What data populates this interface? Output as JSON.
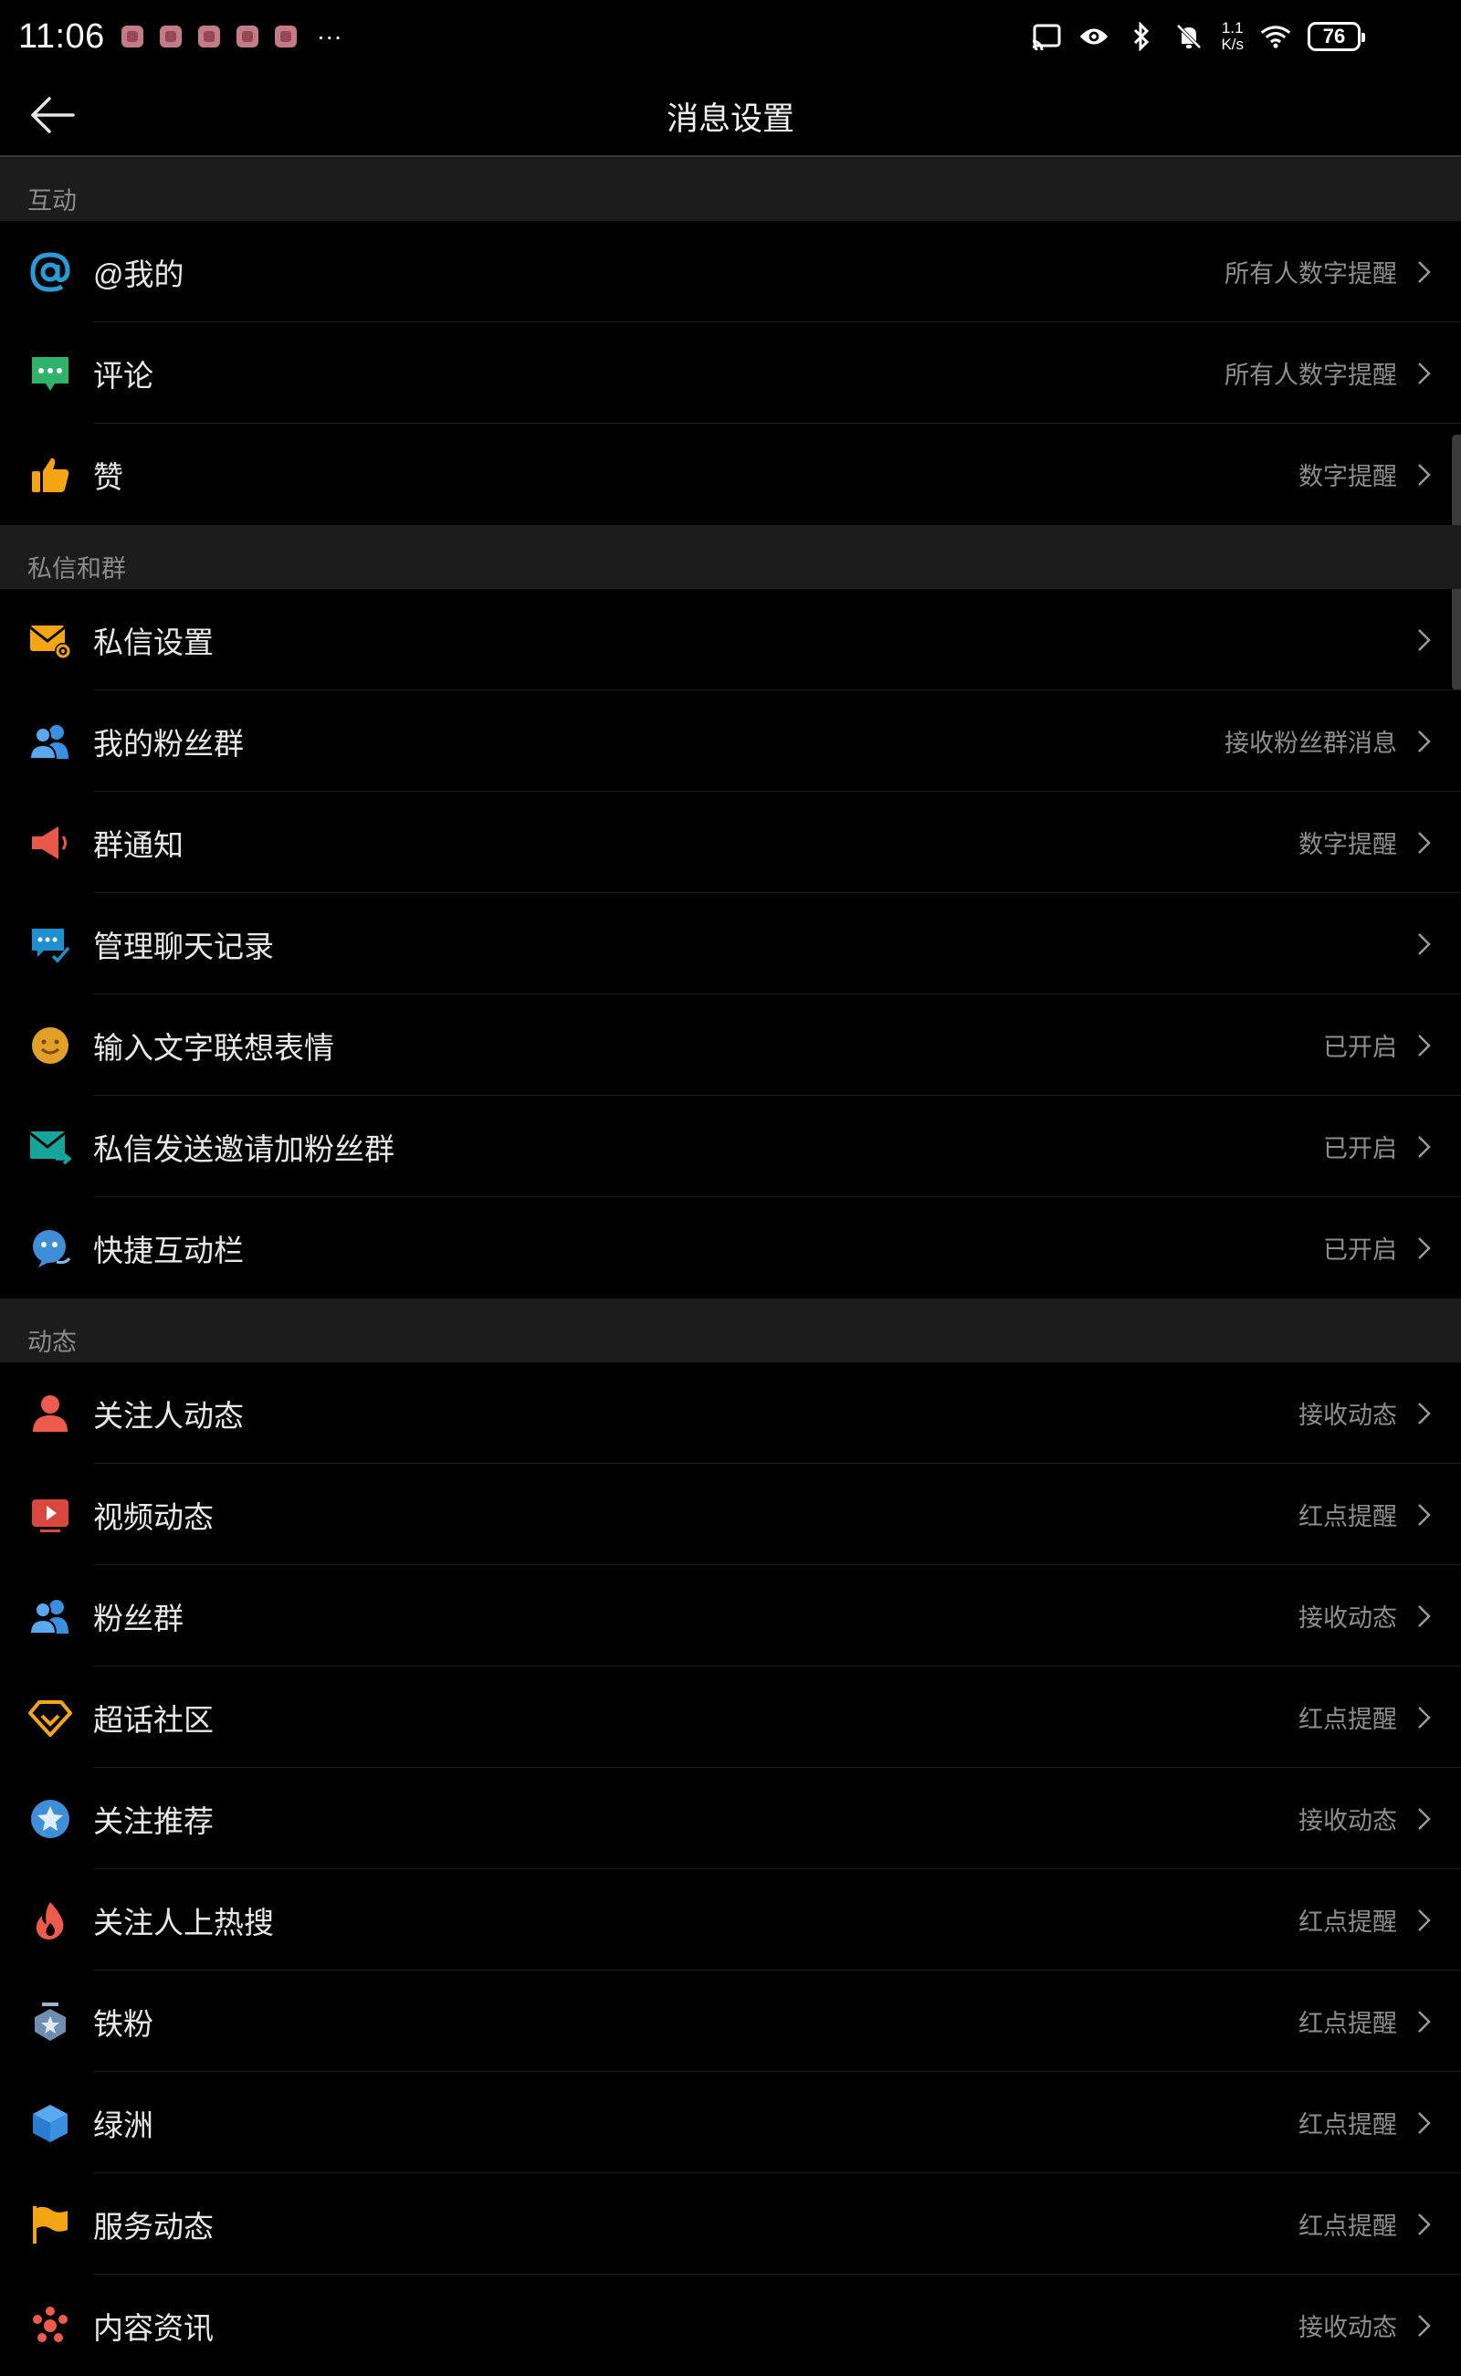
{
  "status_bar": {
    "time": "11:06",
    "more": "···",
    "net_speed_top": "1.1",
    "net_speed_bottom": "K/s",
    "battery": "76"
  },
  "header": {
    "title": "消息设置"
  },
  "sections": [
    {
      "header": "互动",
      "items": [
        {
          "label": "@我的",
          "value": "所有人数字提醒",
          "icon": "at-icon"
        },
        {
          "label": "评论",
          "value": "所有人数字提醒",
          "icon": "comment-icon"
        },
        {
          "label": "赞",
          "value": "数字提醒",
          "icon": "thumbs-up-icon"
        }
      ]
    },
    {
      "header": "私信和群",
      "items": [
        {
          "label": "私信设置",
          "value": "",
          "icon": "mail-settings-icon"
        },
        {
          "label": "我的粉丝群",
          "value": "接收粉丝群消息",
          "icon": "fan-group-icon"
        },
        {
          "label": "群通知",
          "value": "数字提醒",
          "icon": "megaphone-icon"
        },
        {
          "label": "管理聊天记录",
          "value": "",
          "icon": "chat-history-icon"
        },
        {
          "label": "输入文字联想表情",
          "value": "已开启",
          "icon": "smiley-icon"
        },
        {
          "label": "私信发送邀请加粉丝群",
          "value": "已开启",
          "icon": "mail-forward-icon"
        },
        {
          "label": "快捷互动栏",
          "value": "已开启",
          "icon": "chat-bubble-icon"
        }
      ]
    },
    {
      "header": "动态",
      "items": [
        {
          "label": "关注人动态",
          "value": "接收动态",
          "icon": "person-icon"
        },
        {
          "label": "视频动态",
          "value": "红点提醒",
          "icon": "video-icon"
        },
        {
          "label": "粉丝群",
          "value": "接收动态",
          "icon": "fan-group-icon"
        },
        {
          "label": "超话社区",
          "value": "红点提醒",
          "icon": "diamond-icon"
        },
        {
          "label": "关注推荐",
          "value": "接收动态",
          "icon": "star-recommend-icon"
        },
        {
          "label": "关注人上热搜",
          "value": "红点提醒",
          "icon": "fire-icon"
        },
        {
          "label": "铁粉",
          "value": "红点提醒",
          "icon": "medal-icon"
        },
        {
          "label": "绿洲",
          "value": "红点提醒",
          "icon": "cube-icon"
        },
        {
          "label": "服务动态",
          "value": "红点提醒",
          "icon": "flag-icon"
        },
        {
          "label": "内容资讯",
          "value": "接收动态",
          "icon": "news-icon"
        }
      ]
    }
  ]
}
